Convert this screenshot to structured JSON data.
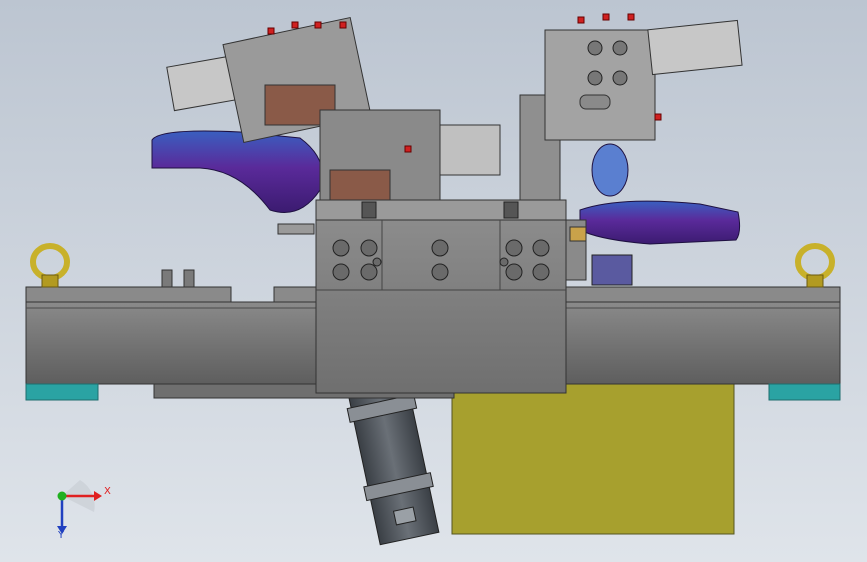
{
  "viewport": {
    "background_top": "#bcc5d1",
    "background_bottom": "#dfe4ea",
    "colors": {
      "base_plate": "#6d6d6d",
      "fixture_block": "#7a7a7a",
      "blue_part": "#2f5fb3",
      "purple_part": "#5a2a9a",
      "teal_pad": "#2aa3a3",
      "yellow_block": "#a7a02e",
      "cylinder": "#4a4f55",
      "lifting_eye": "#c8b12a",
      "clamp_arm": "#8b8b8b",
      "red_bolt": "#d02020",
      "brown_plate": "#8a5a48"
    }
  },
  "triad": {
    "x_label": "X",
    "y_label": "Y",
    "x_color": "#e02020",
    "y_color": "#2040c0",
    "origin_color": "#20b020"
  }
}
